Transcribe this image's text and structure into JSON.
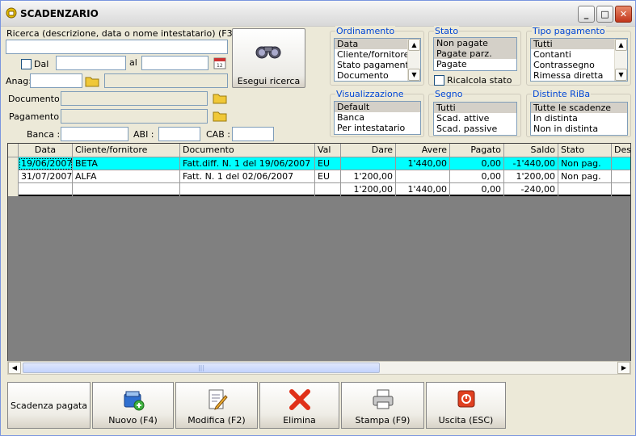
{
  "window": {
    "title": "SCADENZARIO"
  },
  "search": {
    "label": "Ricerca (descrizione, data o nome intestatario) (F3)",
    "value": "",
    "dal_label": "Dal",
    "al_label": "al",
    "anag_label": "Anag:",
    "documento_label": "Documento :",
    "pagamento_label": "Pagamento :",
    "banca_label": "Banca :",
    "abi_label": "ABI :",
    "cab_label": "CAB :",
    "button_label": "Esegui ricerca"
  },
  "ordinamento": {
    "title": "Ordinamento",
    "items": [
      "Data",
      "Cliente/fornitore",
      "Stato pagamento",
      "Documento"
    ],
    "selected": 0
  },
  "stato": {
    "title": "Stato",
    "items": [
      "Non pagate",
      "Pagate parz.",
      "Pagate"
    ],
    "selected": [
      0,
      1
    ],
    "ricalcola_label": "Ricalcola stato"
  },
  "tipo_pagamento": {
    "title": "Tipo pagamento",
    "items": [
      "Tutti",
      "Contanti",
      "Contrassegno",
      "Rimessa diretta"
    ],
    "selected": 0
  },
  "visualizzazione": {
    "title": "Visualizzazione",
    "items": [
      "Default",
      "Banca",
      "Per intestatario"
    ],
    "selected": 0
  },
  "segno": {
    "title": "Segno",
    "items": [
      "Tutti",
      "Scad. attive",
      "Scad. passive"
    ],
    "selected": 0
  },
  "distinte": {
    "title": "Distinte RiBa",
    "items": [
      "Tutte le scadenze",
      "In distinta",
      "Non in distinta"
    ],
    "selected": 0
  },
  "table": {
    "columns": [
      "Data",
      "Cliente/fornitore",
      "Documento",
      "Val",
      "Dare",
      "Avere",
      "Pagato",
      "Saldo",
      "Stato",
      "Des"
    ],
    "rows": [
      [
        "19/06/2007",
        "BETA",
        "Fatt.diff. N. 1 del 19/06/2007",
        "EU",
        "",
        "1'440,00",
        "0,00",
        "-1'440,00",
        "Non pag.",
        ""
      ],
      [
        "31/07/2007",
        "ALFA",
        "Fatt. N. 1 del 02/06/2007",
        "EU",
        "1'200,00",
        "",
        "0,00",
        "1'200,00",
        "Non pag.",
        ""
      ],
      [
        "",
        "",
        "",
        "",
        "1'200,00",
        "1'440,00",
        "0,00",
        "-240,00",
        "",
        ""
      ]
    ],
    "selected_row": 0
  },
  "toolbar": {
    "scadenza_label": "Scadenza pagata",
    "nuovo_label": "Nuovo (F4)",
    "modifica_label": "Modifica (F2)",
    "elimina_label": "Elimina",
    "stampa_label": "Stampa (F9)",
    "uscita_label": "Uscita (ESC)"
  },
  "colors": {
    "selection": "#00ffff",
    "group_title": "#0046d5",
    "window_bg": "#ece9d8"
  }
}
